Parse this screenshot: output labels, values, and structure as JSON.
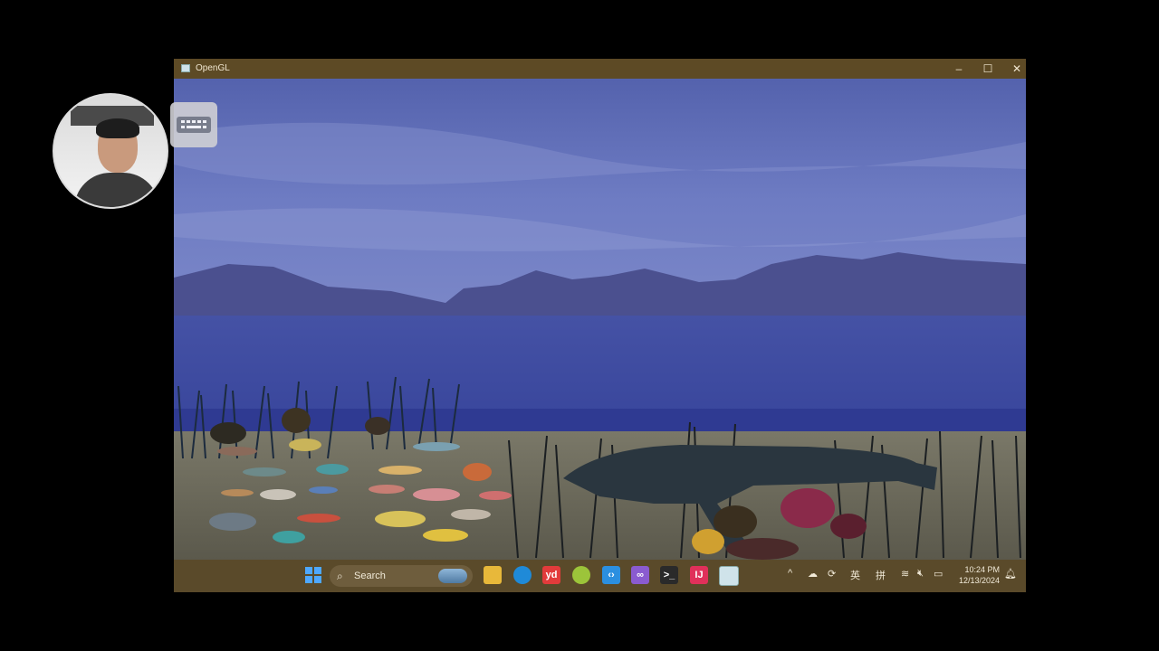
{
  "window": {
    "title": "OpenGL",
    "minimize_glyph": "–",
    "maximize_glyph": "☐",
    "close_glyph": "✕"
  },
  "taskbar": {
    "search_label": "Search",
    "pinned_icons": [
      "windows-start-icon",
      "file-explorer-icon",
      "edge-browser-icon",
      "youdao-dictionary-icon",
      "green-app-icon",
      "vscode-icon",
      "visual-studio-icon",
      "terminal-icon",
      "jetbrains-icon",
      "opengl-window-icon"
    ],
    "tray": {
      "chevron": "^",
      "ime_lang": "英",
      "ime_mode": "拼",
      "time": "10:24 PM",
      "date": "12/13/2024"
    }
  },
  "overlay": {
    "keyboard_button_icon": "keyboard-icon",
    "webcam": "webcam-feed"
  },
  "colors": {
    "titlebar": "#5d4a25",
    "taskbar": "#5a4a2a",
    "sky": "#6a78bf",
    "water": "#3d4ba2"
  }
}
